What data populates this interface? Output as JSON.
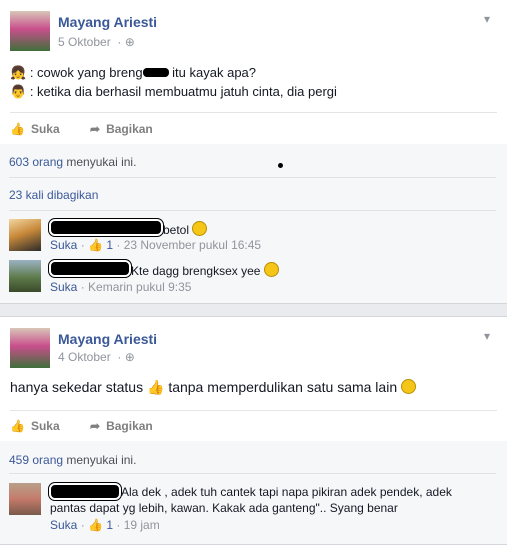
{
  "post1": {
    "author": "Mayang Ariesti",
    "date": "5 Oktober",
    "line1": ": cowok yang breng",
    "line1_after": "itu kayak apa?",
    "line2": ": ketika dia berhasil membuatmu jatuh cinta, dia pergi",
    "like_label": "Suka",
    "share_label": "Bagikan",
    "likes_count": "603 orang",
    "likes_suffix": "menyukai ini.",
    "shares_count": "23 kali dibagikan",
    "comments": [
      {
        "text": "betol",
        "like_label": "Suka",
        "like_count": "1",
        "time": "23 November pukul 16:45"
      },
      {
        "text": "Kte dagg brengksex yee",
        "like_label": "Suka",
        "time": "Kemarin pukul 9:35"
      }
    ]
  },
  "post2": {
    "author": "Mayang Ariesti",
    "date": "4 Oktober",
    "status_before": "hanya sekedar status",
    "status_after": "tanpa memperdulikan satu sama lain",
    "like_label": "Suka",
    "share_label": "Bagikan",
    "likes_count": "459 orang",
    "likes_suffix": "menyukai ini.",
    "comments": [
      {
        "text_line1": "Ala dek , adek tuh cantek tapi napa pikiran adek pendek, adek",
        "text_line2": "pantas dapat yg lebih, kawan. Kakak ada ganteng\".. Syang benar",
        "like_label": "Suka",
        "like_count": "1",
        "time": "19 jam"
      }
    ]
  }
}
